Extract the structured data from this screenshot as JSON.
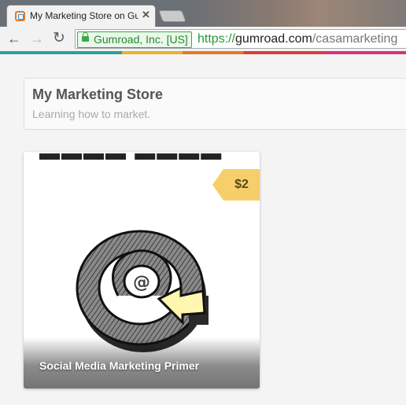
{
  "browser": {
    "tab_title": "My Marketing Store on Gu",
    "close_glyph": "✕",
    "nav": {
      "back_glyph": "←",
      "forward_glyph": "→",
      "reload_glyph": "↻"
    },
    "ev_label": "Gumroad, Inc. [US]",
    "url": {
      "scheme": "https://",
      "host": "gumroad.com",
      "path": "/casamarketing"
    }
  },
  "store": {
    "name": "My Marketing Store",
    "description": "Learning how to market."
  },
  "product": {
    "price": "$2",
    "title": "Social Media Marketing Primer",
    "image_icon": "at-sign-arrow-illustration"
  },
  "colors": {
    "price_tag": "#f7cf6a",
    "ev_green": "#3ba94a"
  }
}
